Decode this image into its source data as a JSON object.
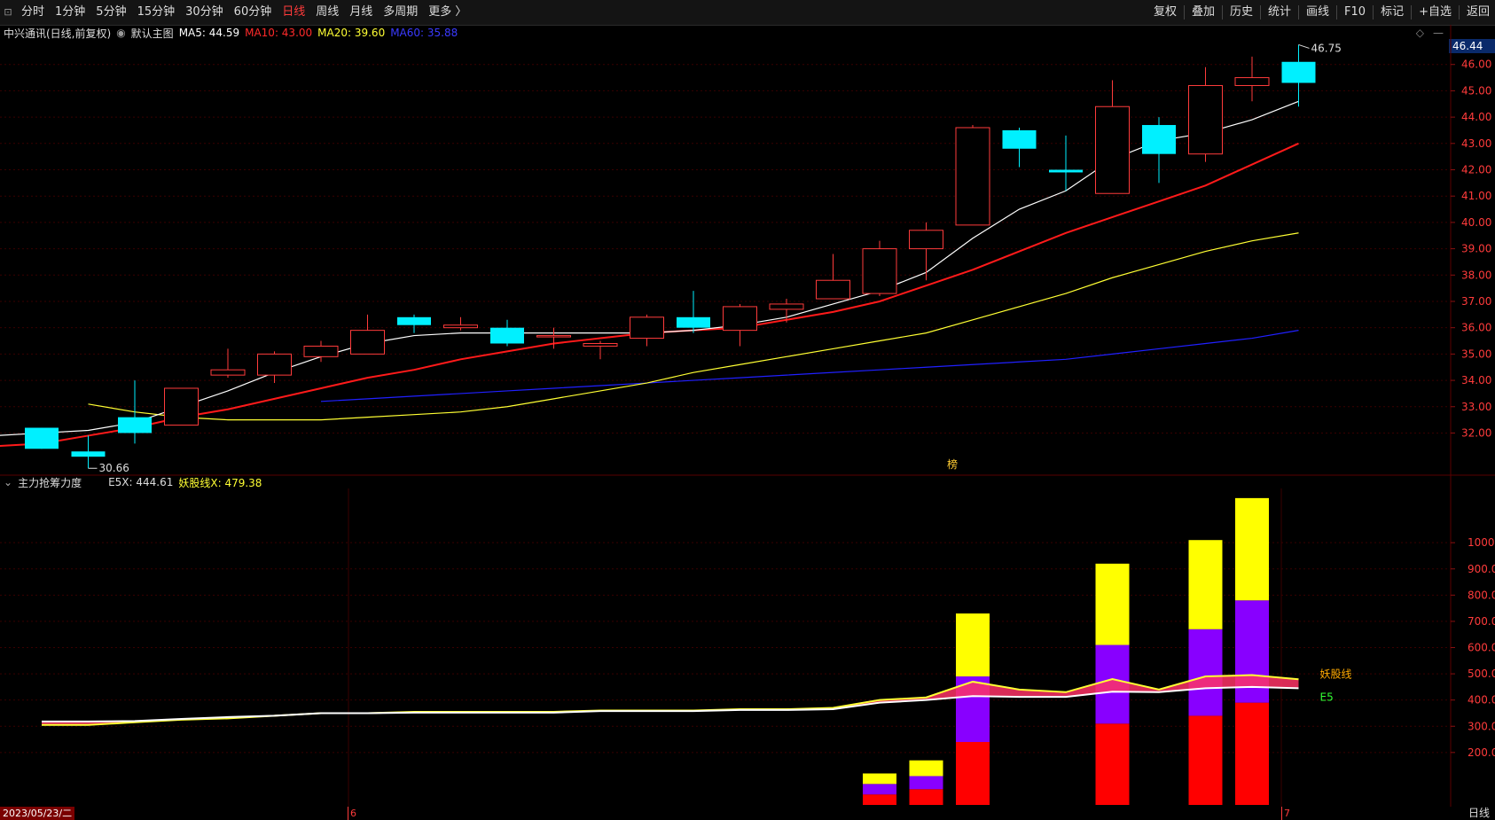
{
  "toolbar": {
    "left_icon": "layout-icon",
    "periods": [
      "分时",
      "1分钟",
      "5分钟",
      "15分钟",
      "30分钟",
      "60分钟",
      "日线",
      "周线",
      "月线",
      "多周期",
      "更多 〉"
    ],
    "active_period": "日线",
    "right": [
      "复权",
      "叠加",
      "历史",
      "统计",
      "画线",
      "F10",
      "标记",
      "+自选",
      "返回"
    ]
  },
  "main_info": {
    "stock": "中兴通讯(日线,前复权)",
    "chart_name": "默认主图",
    "ma5": "MA5: 44.59",
    "ma10": "MA10: 43.00",
    "ma20": "MA20: 39.60",
    "ma60": "MA60: 35.88",
    "current_price": "46.44",
    "high_label": "46.75",
    "low_label": "30.66",
    "marker_label": "榜"
  },
  "sub_info": {
    "indicator": "主力抢筹力度",
    "e5x": "E5X: 444.61",
    "yaogu": "妖股线X: 479.38",
    "line_label_yaogu": "妖股线",
    "line_label_e5": "E5"
  },
  "status": {
    "date": "2023/05/23/二",
    "month_6": "6",
    "month_7": "7",
    "period": "日线"
  },
  "colors": {
    "up": "#ff3b3b",
    "down": "#00f0ff",
    "ma5": "#ffffff",
    "ma10": "#ff1a1a",
    "ma20": "#ffff33",
    "ma60": "#2020ff",
    "bar_red": "#ff0000",
    "bar_purple": "#8800ff",
    "bar_yellow": "#ffff00"
  },
  "chart_data": [
    {
      "type": "candlestick",
      "title": "中兴通讯(日线,前复权)",
      "ylim": [
        30.5,
        46.9
      ],
      "y_ticks": [
        32,
        33,
        34,
        35,
        36,
        37,
        38,
        39,
        40,
        41,
        42,
        43,
        44,
        45,
        46
      ],
      "candles": [
        {
          "o": 32.2,
          "c": 31.4,
          "h": 32.2,
          "l": 31.4
        },
        {
          "o": 31.3,
          "c": 31.1,
          "h": 31.9,
          "l": 30.66
        },
        {
          "o": 32.6,
          "c": 32.0,
          "h": 34.0,
          "l": 31.6
        },
        {
          "o": 32.3,
          "c": 33.7,
          "h": 33.7,
          "l": 32.3
        },
        {
          "o": 34.2,
          "c": 34.4,
          "h": 35.2,
          "l": 34.1
        },
        {
          "o": 34.2,
          "c": 35.0,
          "h": 35.1,
          "l": 33.9
        },
        {
          "o": 34.9,
          "c": 35.3,
          "h": 35.5,
          "l": 34.7
        },
        {
          "o": 35.0,
          "c": 35.9,
          "h": 36.5,
          "l": 35.0
        },
        {
          "o": 36.4,
          "c": 36.1,
          "h": 36.5,
          "l": 35.8
        },
        {
          "o": 36.0,
          "c": 36.1,
          "h": 36.4,
          "l": 35.9
        },
        {
          "o": 36.0,
          "c": 35.4,
          "h": 36.3,
          "l": 35.3
        },
        {
          "o": 35.7,
          "c": 35.7,
          "h": 36.0,
          "l": 35.2
        },
        {
          "o": 35.3,
          "c": 35.4,
          "h": 35.5,
          "l": 34.8
        },
        {
          "o": 35.6,
          "c": 36.4,
          "h": 36.5,
          "l": 35.3
        },
        {
          "o": 36.4,
          "c": 36.0,
          "h": 37.4,
          "l": 35.8
        },
        {
          "o": 35.9,
          "c": 36.8,
          "h": 36.9,
          "l": 35.3
        },
        {
          "o": 36.7,
          "c": 36.9,
          "h": 37.1,
          "l": 36.2
        },
        {
          "o": 37.1,
          "c": 37.8,
          "h": 38.8,
          "l": 37.1
        },
        {
          "o": 37.3,
          "c": 39.0,
          "h": 39.3,
          "l": 37.2
        },
        {
          "o": 39.0,
          "c": 39.7,
          "h": 40.0,
          "l": 37.8
        },
        {
          "o": 39.9,
          "c": 43.6,
          "h": 43.7,
          "l": 39.9
        },
        {
          "o": 43.5,
          "c": 42.8,
          "h": 43.6,
          "l": 42.1
        },
        {
          "o": 42.0,
          "c": 41.9,
          "h": 43.3,
          "l": 41.2
        },
        {
          "o": 41.1,
          "c": 44.4,
          "h": 45.4,
          "l": 41.1
        },
        {
          "o": 43.7,
          "c": 42.6,
          "h": 44.0,
          "l": 41.5
        },
        {
          "o": 42.6,
          "c": 45.2,
          "h": 45.9,
          "l": 42.3
        },
        {
          "o": 45.2,
          "c": 45.5,
          "h": 46.3,
          "l": 44.6
        },
        {
          "o": 46.1,
          "c": 45.3,
          "h": 46.75,
          "l": 44.4
        }
      ],
      "ma5": [
        31.9,
        31.9,
        32.0,
        32.1,
        32.4,
        33.0,
        33.6,
        34.3,
        34.9,
        35.4,
        35.7,
        35.8,
        35.8,
        35.8,
        35.8,
        35.8,
        35.9,
        36.1,
        36.4,
        36.9,
        37.4,
        38.1,
        39.4,
        40.5,
        41.2,
        42.4,
        43.1,
        43.4,
        43.9,
        44.6
      ],
      "ma10": [
        31.5,
        31.5,
        31.6,
        31.9,
        32.2,
        32.6,
        32.9,
        33.3,
        33.7,
        34.1,
        34.4,
        34.8,
        35.1,
        35.4,
        35.6,
        35.8,
        35.9,
        36.0,
        36.3,
        36.6,
        37.0,
        37.6,
        38.2,
        38.9,
        39.6,
        40.2,
        40.8,
        41.4,
        42.2,
        43.0
      ],
      "ma20": [
        33.1,
        32.8,
        32.6,
        32.5,
        32.5,
        32.5,
        32.6,
        32.7,
        32.8,
        33.0,
        33.3,
        33.6,
        33.9,
        34.3,
        34.6,
        34.9,
        35.2,
        35.5,
        35.8,
        36.3,
        36.8,
        37.3,
        37.9,
        38.4,
        38.9,
        39.3,
        39.6
      ],
      "ma60": [
        33.2,
        33.3,
        33.4,
        33.5,
        33.6,
        33.7,
        33.8,
        33.9,
        34.0,
        34.1,
        34.2,
        34.3,
        34.4,
        34.5,
        34.6,
        34.7,
        34.8,
        35.0,
        35.2,
        35.4,
        35.6,
        35.9
      ]
    },
    {
      "type": "bar",
      "title": "主力抢筹力度",
      "ylim": [
        0,
        1200
      ],
      "y_ticks": [
        200,
        300,
        400,
        500,
        600,
        700,
        800,
        900,
        1000
      ],
      "stacked_bars": [
        {
          "index": 18,
          "red": 40,
          "purple": 40,
          "yellow": 40
        },
        {
          "index": 19,
          "red": 60,
          "purple": 50,
          "yellow": 60
        },
        {
          "index": 20,
          "red": 240,
          "purple": 250,
          "yellow": 240
        },
        {
          "index": 23,
          "red": 310,
          "purple": 300,
          "yellow": 310
        },
        {
          "index": 25,
          "red": 340,
          "purple": 330,
          "yellow": 340
        },
        {
          "index": 26,
          "red": 390,
          "purple": 390,
          "yellow": 390
        }
      ],
      "series": [
        {
          "name": "妖股线",
          "values": [
            305,
            305,
            315,
            325,
            330,
            340,
            350,
            350,
            355,
            355,
            355,
            355,
            360,
            360,
            360,
            365,
            365,
            370,
            400,
            410,
            470,
            440,
            430,
            480,
            440,
            490,
            495,
            479
          ]
        },
        {
          "name": "E5",
          "values": [
            318,
            318,
            320,
            328,
            335,
            340,
            350,
            350,
            352,
            352,
            352,
            352,
            358,
            358,
            358,
            362,
            362,
            365,
            390,
            400,
            415,
            412,
            412,
            432,
            430,
            445,
            450,
            445
          ]
        }
      ]
    }
  ]
}
